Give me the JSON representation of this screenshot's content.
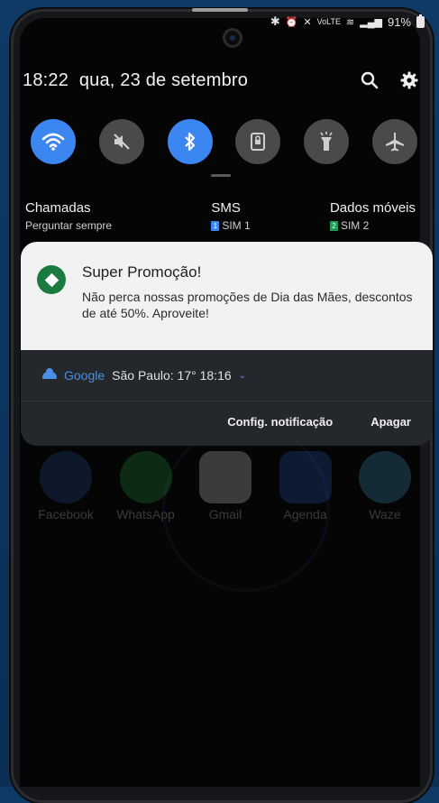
{
  "status_bar": {
    "battery_percent": "91%"
  },
  "header": {
    "time": "18:22",
    "date": "qua, 23 de setembro"
  },
  "quick_settings": [
    {
      "name": "wifi-icon",
      "on": true
    },
    {
      "name": "sound-muted-icon",
      "on": false
    },
    {
      "name": "bluetooth-icon",
      "on": true
    },
    {
      "name": "screen-lock-icon",
      "on": false
    },
    {
      "name": "flashlight-icon",
      "on": false
    },
    {
      "name": "airplane-mode-icon",
      "on": false
    }
  ],
  "sim_settings": {
    "calls": {
      "title": "Chamadas",
      "value": "Perguntar sempre"
    },
    "sms": {
      "title": "SMS",
      "badge": "1",
      "value": "SIM 1",
      "badge_color": "#3b86f0"
    },
    "data": {
      "title": "Dados móveis",
      "badge": "2",
      "value": "SIM 2",
      "badge_color": "#1b9a5a"
    }
  },
  "notification": {
    "title": "Super Promoção!",
    "body": "Não perca nossas promoções de Dia das Mães, descontos de até 50%. Aproveite!",
    "accent": "#1b7a3f"
  },
  "weather": {
    "brand": "Google",
    "info": "São Paulo: 17°  18:16",
    "chevron": "⌄"
  },
  "actions": {
    "settings_label": "Config. notificação",
    "clear_label": "Apagar"
  },
  "dock": {
    "facebook": "Facebook",
    "whatsapp": "WhatsApp",
    "gmail": "Gmail",
    "agenda": "Agenda",
    "waze": "Waze"
  }
}
